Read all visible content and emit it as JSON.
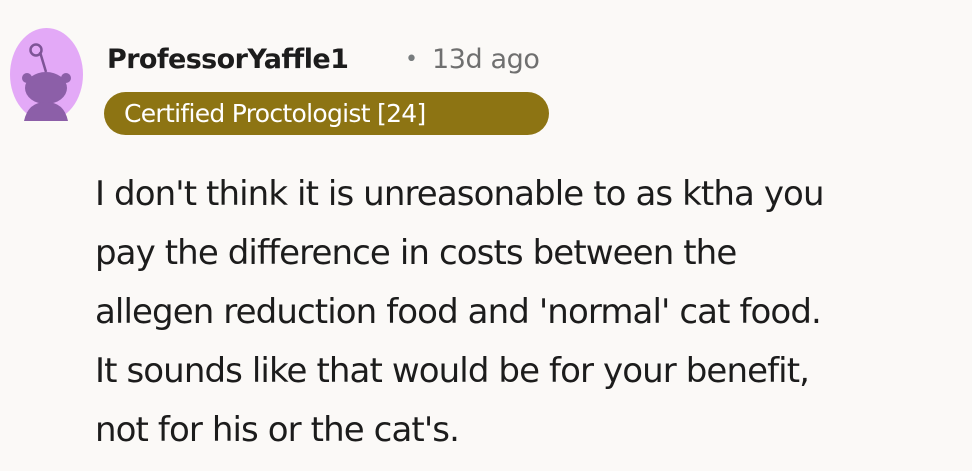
{
  "comment": {
    "avatar": {
      "icon": "reddit-snoo-avatar-icon",
      "background_color": "#e3a9f7",
      "figure_color": "#8c5fa8"
    },
    "username": "ProfessorYaffle1",
    "separator": "•",
    "timestamp": "13d ago",
    "flair": {
      "text": "Certified Proctologist [24]",
      "background_color": "#8d7413",
      "text_color": "#ffffff"
    },
    "body_lines": [
      "I don't think it is unreasonable to as ktha you",
      "pay the difference in costs between the",
      "allegen reduction food and 'normal' cat food.",
      "It sounds like that would be for your benefit,",
      "not for his or the cat's."
    ]
  }
}
